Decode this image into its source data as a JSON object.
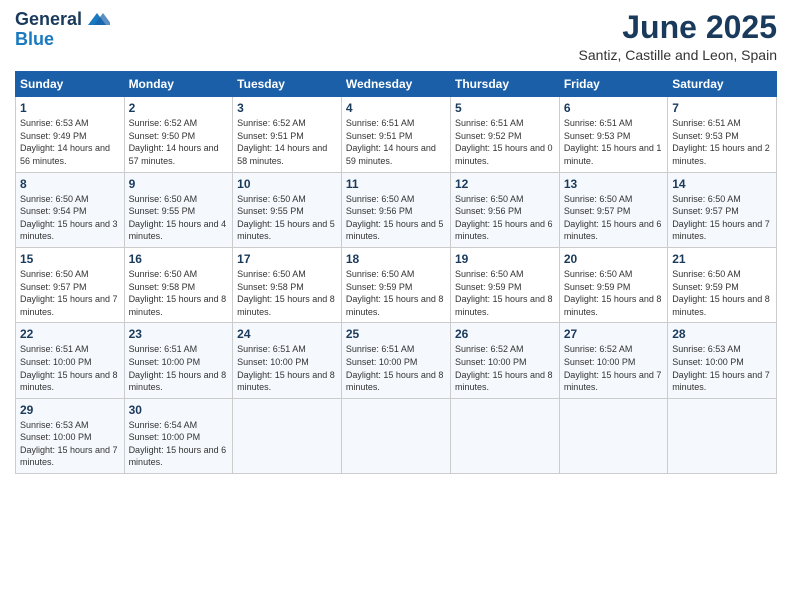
{
  "logo": {
    "line1": "General",
    "line2": "Blue"
  },
  "title": "June 2025",
  "subtitle": "Santiz, Castille and Leon, Spain",
  "weekdays": [
    "Sunday",
    "Monday",
    "Tuesday",
    "Wednesday",
    "Thursday",
    "Friday",
    "Saturday"
  ],
  "weeks": [
    [
      {
        "day": "1",
        "sunrise": "6:53 AM",
        "sunset": "9:49 PM",
        "daylight": "14 hours and 56 minutes."
      },
      {
        "day": "2",
        "sunrise": "6:52 AM",
        "sunset": "9:50 PM",
        "daylight": "14 hours and 57 minutes."
      },
      {
        "day": "3",
        "sunrise": "6:52 AM",
        "sunset": "9:51 PM",
        "daylight": "14 hours and 58 minutes."
      },
      {
        "day": "4",
        "sunrise": "6:51 AM",
        "sunset": "9:51 PM",
        "daylight": "14 hours and 59 minutes."
      },
      {
        "day": "5",
        "sunrise": "6:51 AM",
        "sunset": "9:52 PM",
        "daylight": "15 hours and 0 minutes."
      },
      {
        "day": "6",
        "sunrise": "6:51 AM",
        "sunset": "9:53 PM",
        "daylight": "15 hours and 1 minute."
      },
      {
        "day": "7",
        "sunrise": "6:51 AM",
        "sunset": "9:53 PM",
        "daylight": "15 hours and 2 minutes."
      }
    ],
    [
      {
        "day": "8",
        "sunrise": "6:50 AM",
        "sunset": "9:54 PM",
        "daylight": "15 hours and 3 minutes."
      },
      {
        "day": "9",
        "sunrise": "6:50 AM",
        "sunset": "9:55 PM",
        "daylight": "15 hours and 4 minutes."
      },
      {
        "day": "10",
        "sunrise": "6:50 AM",
        "sunset": "9:55 PM",
        "daylight": "15 hours and 5 minutes."
      },
      {
        "day": "11",
        "sunrise": "6:50 AM",
        "sunset": "9:56 PM",
        "daylight": "15 hours and 5 minutes."
      },
      {
        "day": "12",
        "sunrise": "6:50 AM",
        "sunset": "9:56 PM",
        "daylight": "15 hours and 6 minutes."
      },
      {
        "day": "13",
        "sunrise": "6:50 AM",
        "sunset": "9:57 PM",
        "daylight": "15 hours and 6 minutes."
      },
      {
        "day": "14",
        "sunrise": "6:50 AM",
        "sunset": "9:57 PM",
        "daylight": "15 hours and 7 minutes."
      }
    ],
    [
      {
        "day": "15",
        "sunrise": "6:50 AM",
        "sunset": "9:57 PM",
        "daylight": "15 hours and 7 minutes."
      },
      {
        "day": "16",
        "sunrise": "6:50 AM",
        "sunset": "9:58 PM",
        "daylight": "15 hours and 8 minutes."
      },
      {
        "day": "17",
        "sunrise": "6:50 AM",
        "sunset": "9:58 PM",
        "daylight": "15 hours and 8 minutes."
      },
      {
        "day": "18",
        "sunrise": "6:50 AM",
        "sunset": "9:59 PM",
        "daylight": "15 hours and 8 minutes."
      },
      {
        "day": "19",
        "sunrise": "6:50 AM",
        "sunset": "9:59 PM",
        "daylight": "15 hours and 8 minutes."
      },
      {
        "day": "20",
        "sunrise": "6:50 AM",
        "sunset": "9:59 PM",
        "daylight": "15 hours and 8 minutes."
      },
      {
        "day": "21",
        "sunrise": "6:50 AM",
        "sunset": "9:59 PM",
        "daylight": "15 hours and 8 minutes."
      }
    ],
    [
      {
        "day": "22",
        "sunrise": "6:51 AM",
        "sunset": "10:00 PM",
        "daylight": "15 hours and 8 minutes."
      },
      {
        "day": "23",
        "sunrise": "6:51 AM",
        "sunset": "10:00 PM",
        "daylight": "15 hours and 8 minutes."
      },
      {
        "day": "24",
        "sunrise": "6:51 AM",
        "sunset": "10:00 PM",
        "daylight": "15 hours and 8 minutes."
      },
      {
        "day": "25",
        "sunrise": "6:51 AM",
        "sunset": "10:00 PM",
        "daylight": "15 hours and 8 minutes."
      },
      {
        "day": "26",
        "sunrise": "6:52 AM",
        "sunset": "10:00 PM",
        "daylight": "15 hours and 8 minutes."
      },
      {
        "day": "27",
        "sunrise": "6:52 AM",
        "sunset": "10:00 PM",
        "daylight": "15 hours and 7 minutes."
      },
      {
        "day": "28",
        "sunrise": "6:53 AM",
        "sunset": "10:00 PM",
        "daylight": "15 hours and 7 minutes."
      }
    ],
    [
      {
        "day": "29",
        "sunrise": "6:53 AM",
        "sunset": "10:00 PM",
        "daylight": "15 hours and 7 minutes."
      },
      {
        "day": "30",
        "sunrise": "6:54 AM",
        "sunset": "10:00 PM",
        "daylight": "15 hours and 6 minutes."
      },
      null,
      null,
      null,
      null,
      null
    ]
  ]
}
